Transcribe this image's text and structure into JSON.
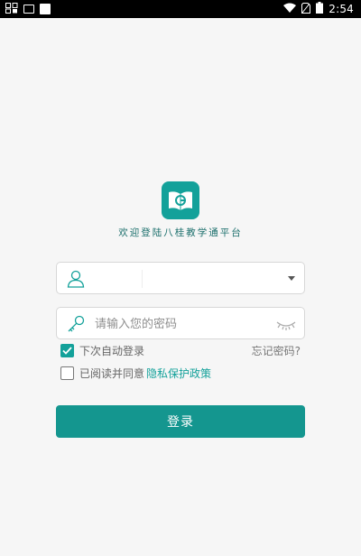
{
  "status_bar": {
    "time": "2:54",
    "left_icons": [
      "notification-icon",
      "sim-icon",
      "app-icon"
    ],
    "right_icons": [
      "wifi-icon",
      "no-sim-icon",
      "battery-icon"
    ]
  },
  "app": {
    "logo_icon": "book-logo-icon",
    "welcome_text": "欢迎登陆八桂教学通平台",
    "brand_color": "#13a19a"
  },
  "form": {
    "username": {
      "value": "",
      "icon": "user-icon",
      "dropdown_icon": "caret-down-icon"
    },
    "password": {
      "placeholder": "请输入您的密码",
      "icon": "key-icon",
      "toggle_icon": "eye-closed-icon"
    },
    "remember": {
      "label": "下次自动登录",
      "checked": true
    },
    "forgot_label": "忘记密码?",
    "agree": {
      "label": "已阅读并同意",
      "checked": false,
      "link": "隐私保护政策"
    },
    "login_label": "登录"
  }
}
